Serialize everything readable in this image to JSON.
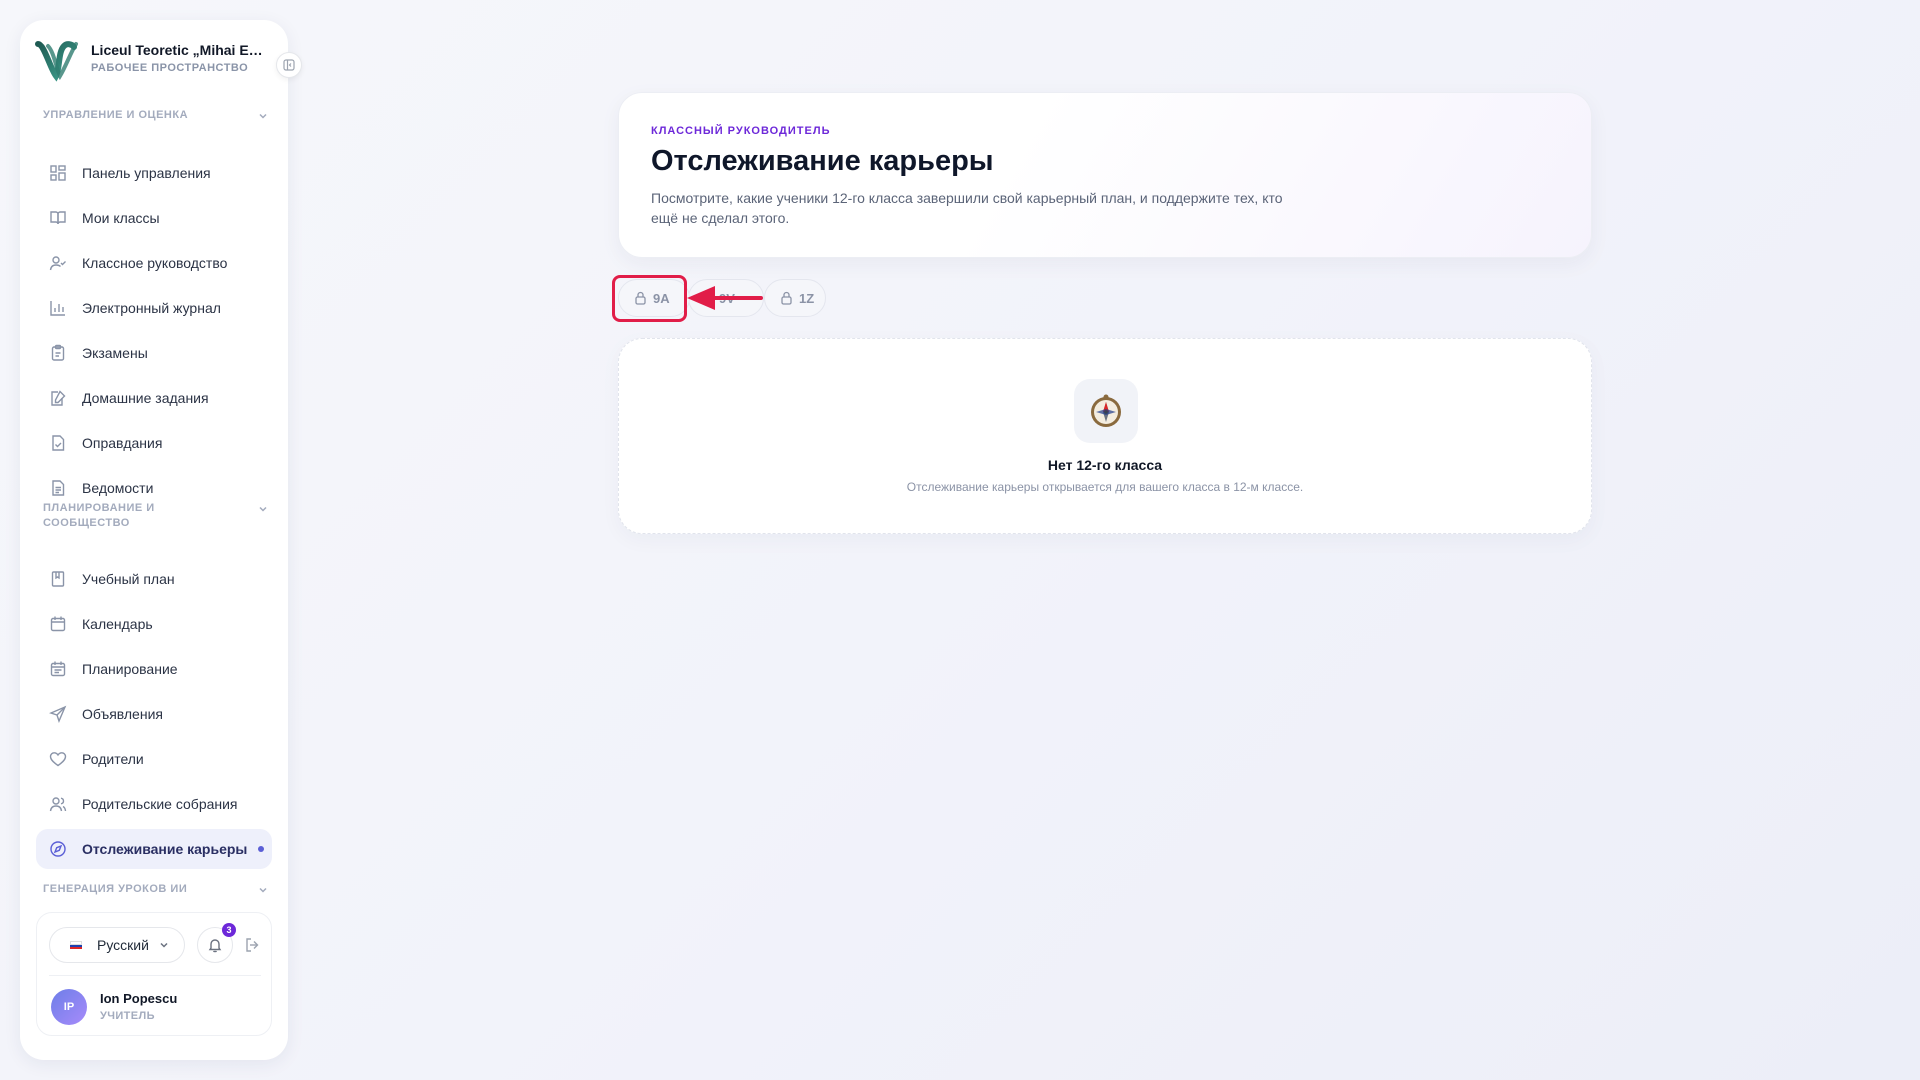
{
  "sidebar": {
    "brand": {
      "name": "Liceul Teoretic „Mihai Eminescu”",
      "subtitle": "РАБОЧЕЕ ПРОСТРАНСТВО"
    },
    "sections": [
      {
        "title": "УПРАВЛЕНИЕ И ОЦЕНКА"
      },
      {
        "title": "ПЛАНИРОВАНИЕ И СООБЩЕСТВО"
      },
      {
        "title": "ГЕНЕРАЦИЯ УРОКОВ ИИ"
      }
    ],
    "items": [
      {
        "label": "Панель управления",
        "icon": "dashboard-icon"
      },
      {
        "label": "Мои классы",
        "icon": "book-open-icon"
      },
      {
        "label": "Классное руководство",
        "icon": "user-check-icon"
      },
      {
        "label": "Электронный журнал",
        "icon": "bar-chart-icon"
      },
      {
        "label": "Экзамены",
        "icon": "clipboard-icon"
      },
      {
        "label": "Домашние задания",
        "icon": "edit-note-icon"
      },
      {
        "label": "Оправдания",
        "icon": "file-check-icon"
      },
      {
        "label": "Ведомости",
        "icon": "file-text-icon"
      },
      {
        "label": "Учебный план",
        "icon": "bookmark-book-icon"
      },
      {
        "label": "Календарь",
        "icon": "calendar-icon"
      },
      {
        "label": "Планирование",
        "icon": "calendar-list-icon"
      },
      {
        "label": "Объявления",
        "icon": "send-icon"
      },
      {
        "label": "Родители",
        "icon": "heart-icon"
      },
      {
        "label": "Родительские собрания",
        "icon": "users-icon"
      },
      {
        "label": "Отслеживание карьеры",
        "icon": "compass-icon",
        "active": true
      }
    ],
    "footer": {
      "language": "Русский",
      "notifications_count": "3",
      "user": {
        "initials": "IP",
        "name": "Ion Popescu",
        "role": "УЧИТЕЛЬ"
      }
    }
  },
  "hero": {
    "kicker": "КЛАССНЫЙ РУКОВОДИТЕЛЬ",
    "title": "Отслеживание карьеры",
    "description": "Посмотрите, какие ученики 12-го класса завершили свой карьерный план, и поддержите тех, кто ещё не сделал этого."
  },
  "class_tabs": [
    {
      "label": "9A",
      "locked": true
    },
    {
      "label": "9V",
      "locked": false
    },
    {
      "label": "1Z",
      "locked": true
    }
  ],
  "empty_state": {
    "title": "Нет 12-го класса",
    "subtitle": "Отслеживание карьеры открывается для вашего класса в 12-м классе."
  },
  "colors": {
    "accent": "#6d28d9",
    "active_bg": "#eef0fb",
    "highlight": "#e11d48"
  }
}
